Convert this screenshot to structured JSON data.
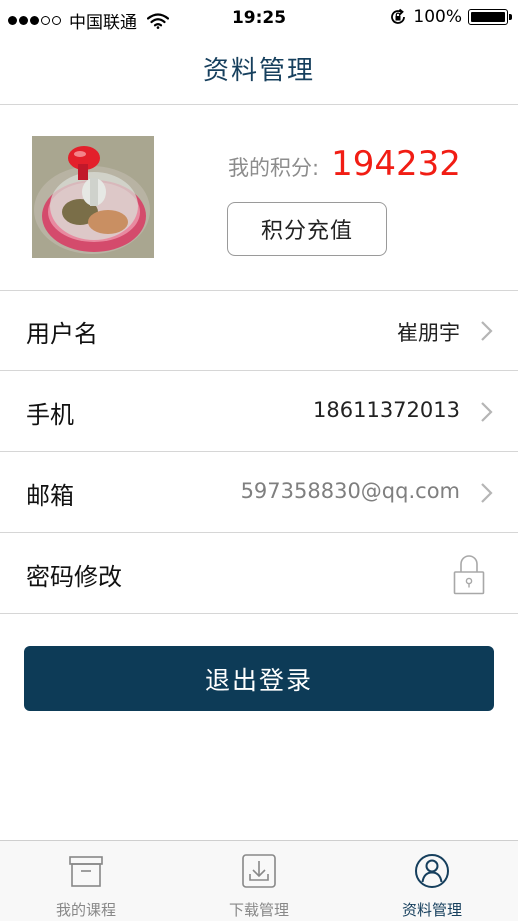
{
  "status_bar": {
    "carrier": "中国联通",
    "time": "19:25",
    "battery": "100%",
    "battery_level": 1.0,
    "signal_bars_filled": 3,
    "signal_bars_total": 5
  },
  "nav": {
    "title": "资料管理"
  },
  "profile": {
    "points_label": "我的积分:",
    "points_value": "194232",
    "recharge_label": "积分充值"
  },
  "rows": [
    {
      "label": "用户名",
      "value": "崔朋宇",
      "icon": "chevron-right-icon"
    },
    {
      "label": "手机",
      "value": "18611372013",
      "icon": "chevron-right-icon"
    },
    {
      "label": "邮箱",
      "value": "597358830@qq.com",
      "icon": "chevron-right-icon"
    },
    {
      "label": "密码修改",
      "value": "",
      "icon": "lock-icon"
    }
  ],
  "logout_label": "退出登录",
  "tabs": [
    {
      "label": "我的课程",
      "icon": "archive-box-icon",
      "active": false
    },
    {
      "label": "下载管理",
      "icon": "download-icon",
      "active": false
    },
    {
      "label": "资料管理",
      "icon": "user-circle-icon",
      "active": true
    }
  ],
  "colors": {
    "nav_title": "#163f5d",
    "points_value": "#f11d14",
    "logout_bg": "#0d3b57",
    "active_tab": "#163f5d"
  }
}
